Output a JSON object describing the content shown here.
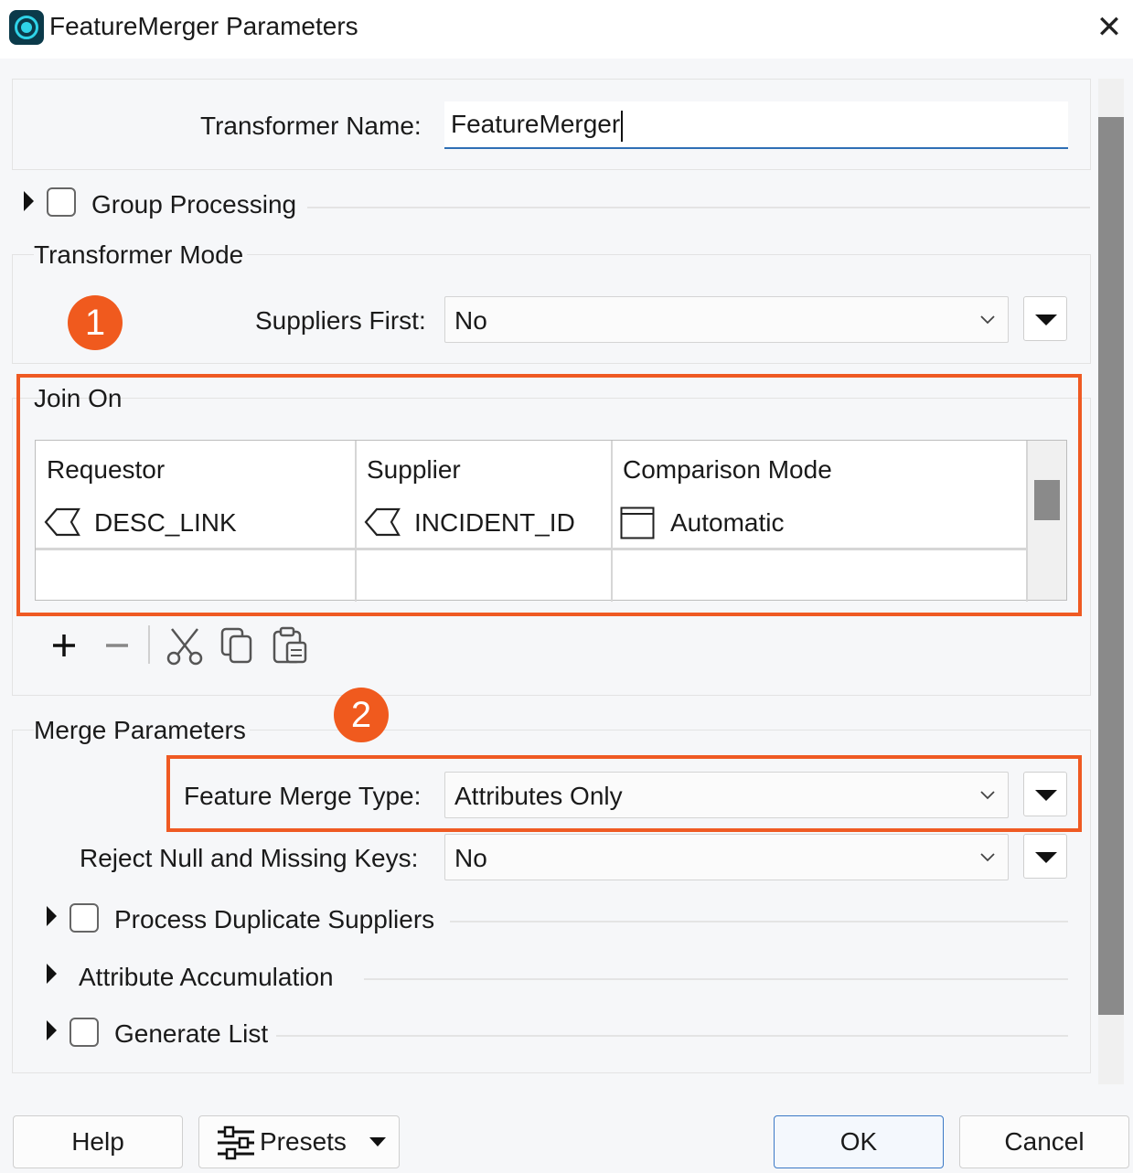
{
  "window": {
    "title": "FeatureMerger Parameters",
    "close_glyph": "✕",
    "app_icon": "fme-icon"
  },
  "transformer": {
    "name_label": "Transformer Name:",
    "name_value": "FeatureMerger"
  },
  "group_processing": {
    "label": "Group Processing"
  },
  "transformer_mode": {
    "title": "Transformer Mode",
    "suppliers_first_label": "Suppliers First:",
    "suppliers_first_value": "No"
  },
  "annotations": {
    "badge_1": "1",
    "badge_2": "2",
    "highlight_color": "#ef5a23"
  },
  "join_on": {
    "title": "Join On",
    "columns": [
      "Requestor",
      "Supplier",
      "Comparison Mode"
    ],
    "rows": [
      {
        "requestor": "DESC_LINK",
        "supplier": "INCIDENT_ID",
        "comparison_mode": "Automatic"
      }
    ]
  },
  "toolbar": {
    "add": "add-icon",
    "remove": "remove-icon",
    "cut": "cut-icon",
    "copy": "copy-icon",
    "paste": "paste-icon"
  },
  "merge_parameters": {
    "title": "Merge Parameters",
    "feature_merge_type_label": "Feature Merge Type:",
    "feature_merge_type_value": "Attributes Only",
    "reject_null_label": "Reject Null and Missing Keys:",
    "reject_null_value": "No",
    "process_duplicate_label": "Process Duplicate Suppliers",
    "attribute_accumulation_label": "Attribute Accumulation",
    "generate_list_label": "Generate List"
  },
  "buttons": {
    "help": "Help",
    "presets": "Presets",
    "ok": "OK",
    "cancel": "Cancel"
  },
  "colors": {
    "accent": "#2e6fb5",
    "annotation": "#f05a1e"
  }
}
